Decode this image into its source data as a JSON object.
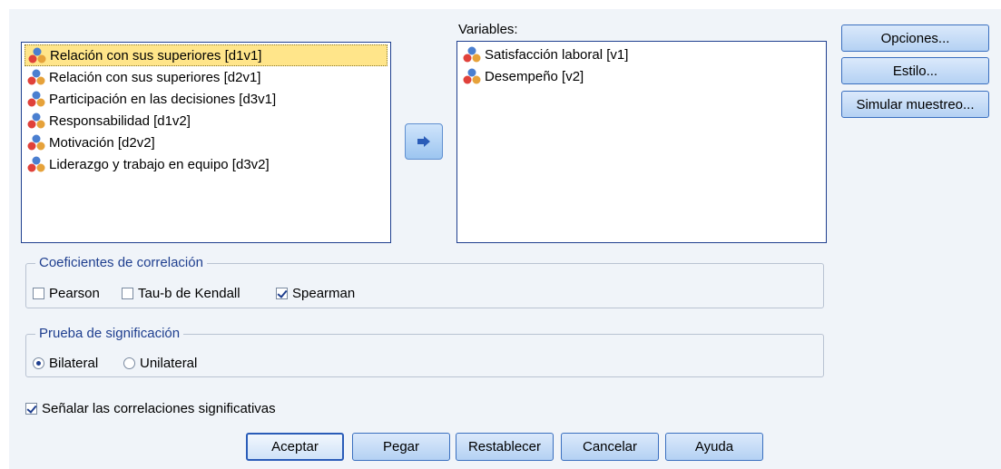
{
  "source_list": {
    "items": [
      {
        "label": "Relación con sus superiores [d1v1]",
        "selected": true
      },
      {
        "label": "Relación con sus superiores [d2v1]",
        "selected": false
      },
      {
        "label": "Participación en las decisiones [d3v1]",
        "selected": false
      },
      {
        "label": "Responsabilidad [d1v2]",
        "selected": false
      },
      {
        "label": "Motivación [d2v2]",
        "selected": false
      },
      {
        "label": "Liderazgo y trabajo en equipo [d3v2]",
        "selected": false
      }
    ]
  },
  "variables": {
    "label": "Variables:",
    "items": [
      {
        "label": "Satisfacción laboral [v1]"
      },
      {
        "label": "Desempeño [v2]"
      }
    ]
  },
  "side_buttons": {
    "options": "Opciones...",
    "style": "Estilo...",
    "bootstrap": "Simular muestreo..."
  },
  "correlation_coefficients": {
    "title": "Coeficientes de correlación",
    "pearson": {
      "label": "Pearson",
      "checked": false
    },
    "kendall": {
      "label": "Tau-b de Kendall",
      "checked": false
    },
    "spearman": {
      "label": "Spearman",
      "checked": true
    }
  },
  "significance_test": {
    "title": "Prueba de significación",
    "two_tailed": {
      "label": "Bilateral",
      "selected": true
    },
    "one_tailed": {
      "label": "Unilateral",
      "selected": false
    }
  },
  "flag_significant": {
    "label": "Señalar las correlaciones significativas",
    "checked": true
  },
  "buttons": {
    "ok": "Aceptar",
    "paste": "Pegar",
    "reset": "Restablecer",
    "cancel": "Cancelar",
    "help": "Ayuda"
  },
  "colors": {
    "accent": "#1f3f8f",
    "selection": "#ffe58a",
    "dialog_bg": "#f0f4f9"
  },
  "icons": {
    "variable": "scale-variable-icon",
    "move": "arrow-right-icon"
  }
}
